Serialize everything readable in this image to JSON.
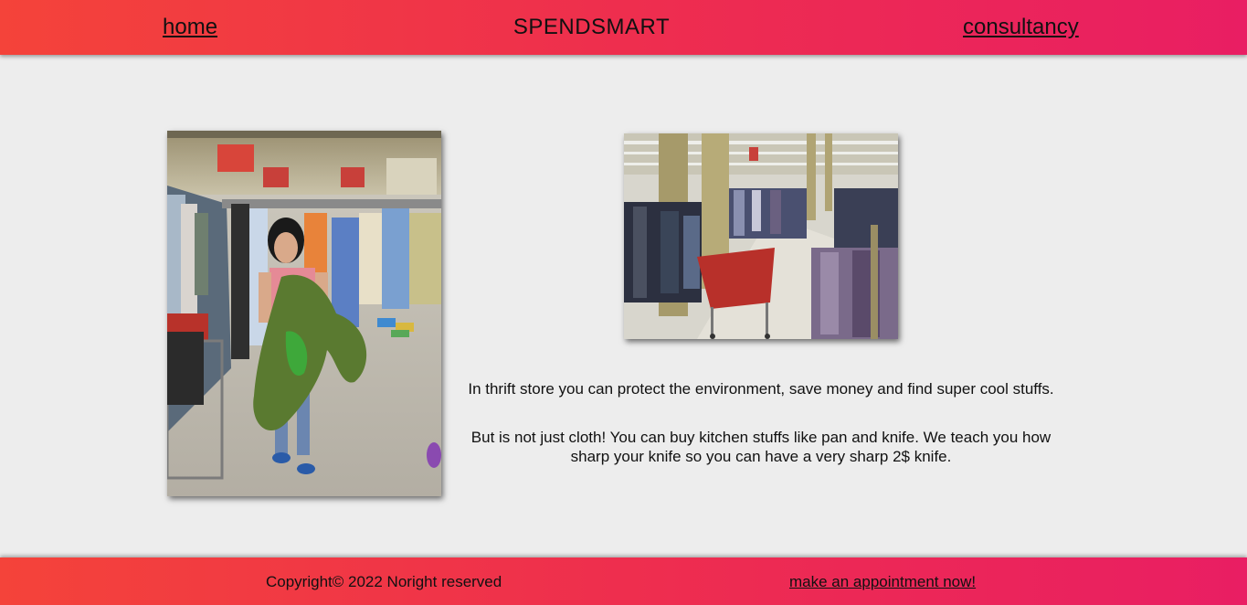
{
  "navbar": {
    "home_label": "home",
    "brand": "SPENDSMART",
    "consultancy_label": "consultancy"
  },
  "main": {
    "paragraph_1": "In thrift store you can protect the environment, save money and find super cool stuffs.",
    "paragraph_2": "But is not just cloth! You can buy kitchen stuffs like pan and knife. We teach you how sharp your knife so you can have a very sharp 2$ knife."
  },
  "footer": {
    "copyright": "Copyright© 2022 Noright reserved",
    "appointment_label": "make an appointment now!"
  },
  "colors": {
    "gradient_start": "#f4433a",
    "gradient_end": "#e91e63",
    "background": "#ededed"
  }
}
